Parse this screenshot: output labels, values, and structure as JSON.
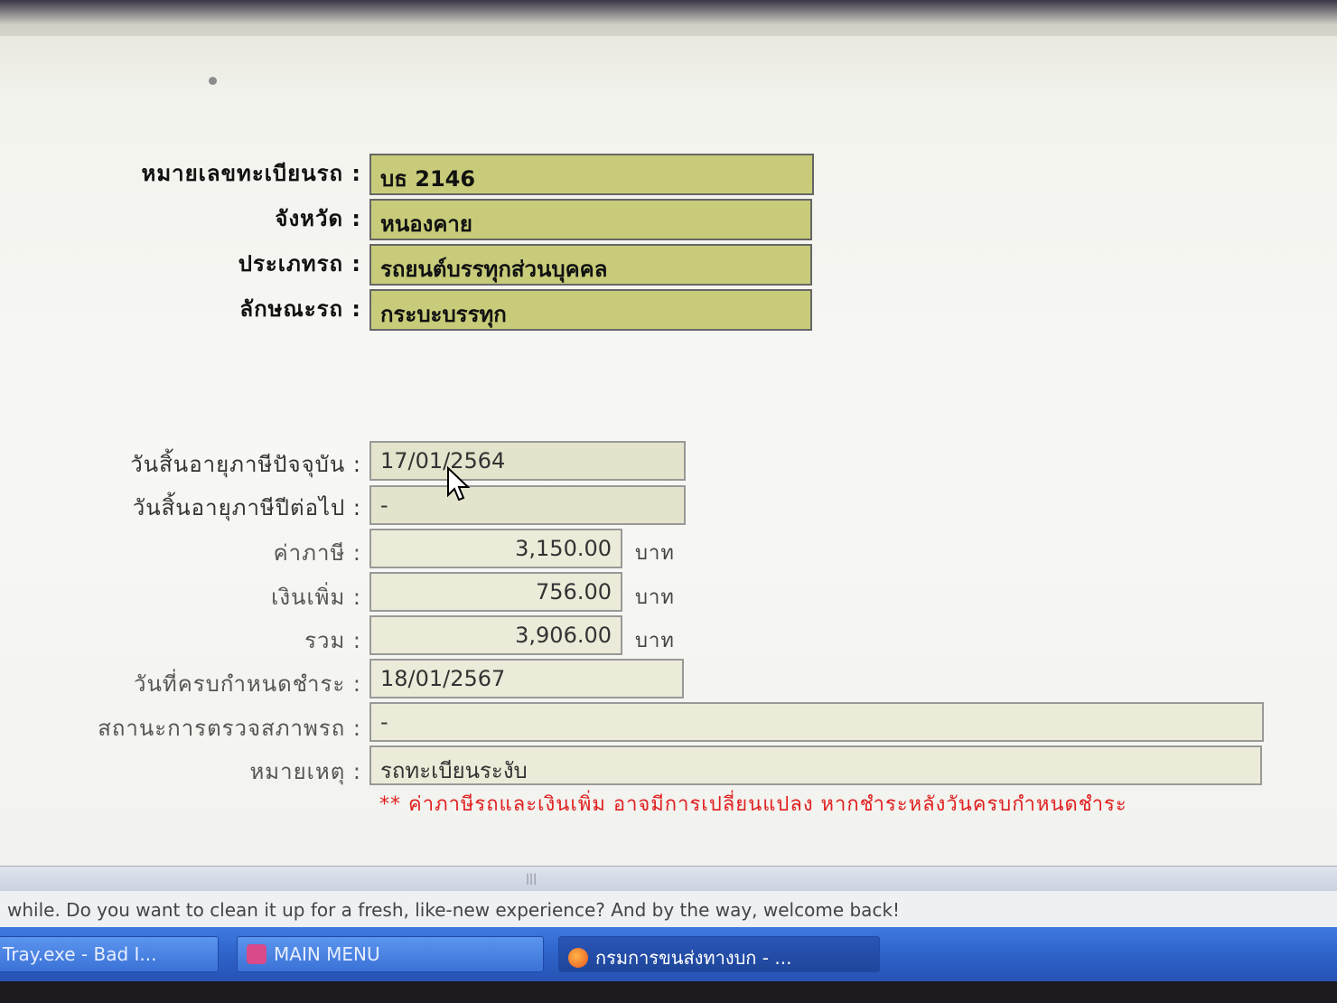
{
  "vehicle": {
    "plate": {
      "label": "หมายเลขทะเบียนรถ :",
      "value": "บธ 2146"
    },
    "province": {
      "label": "จังหวัด :",
      "value": "หนองคาย"
    },
    "type": {
      "label": "ประเภทรถ :",
      "value": "รถยนต์บรรทุกส่วนบุคคล"
    },
    "body": {
      "label": "ลักษณะรถ :",
      "value": "กระบะบรรทุก"
    }
  },
  "tax": {
    "current_expiry": {
      "label": "วันสิ้นอายุภาษีปัจจุบัน :",
      "value": "17/01/2564"
    },
    "next_expiry": {
      "label": "วันสิ้นอายุภาษีปีต่อไป :",
      "value": "-"
    },
    "tax_amount": {
      "label": "ค่าภาษี :",
      "value": "3,150.00",
      "unit": "บาท"
    },
    "surcharge": {
      "label": "เงินเพิ่ม :",
      "value": "756.00",
      "unit": "บาท"
    },
    "total": {
      "label": "รวม :",
      "value": "3,906.00",
      "unit": "บาท"
    },
    "due_date": {
      "label": "วันที่ครบกำหนดชำระ :",
      "value": "18/01/2567"
    },
    "inspection_status": {
      "label": "สถานะการตรวจสภาพรถ :",
      "value": "-"
    },
    "remark": {
      "label": "หมายเหตุ :",
      "value": "รถทะเบียนระงับ"
    },
    "warning": "** ค่าภาษีรถและเงินเพิ่ม อาจมีการเปลี่ยนแปลง หากชำระหลังวันครบกำหนดชำระ"
  },
  "notice_bar": {
    "text": "while. Do you want to clean it up for a fresh, like-new experience? And by the way, welcome back!"
  },
  "taskbar": {
    "items": [
      {
        "label": "Tray.exe - Bad I...",
        "icon": "app-icon"
      },
      {
        "label": "MAIN MENU",
        "icon": "menu-app-icon"
      },
      {
        "label": "กรมการขนส่งทางบก - ...",
        "icon": "firefox-icon"
      }
    ]
  },
  "colors": {
    "highlight_field": "#c8cc7a",
    "plain_field": "#ecebd9",
    "warning_text": "#e02020",
    "taskbar": "#2f63c9"
  }
}
